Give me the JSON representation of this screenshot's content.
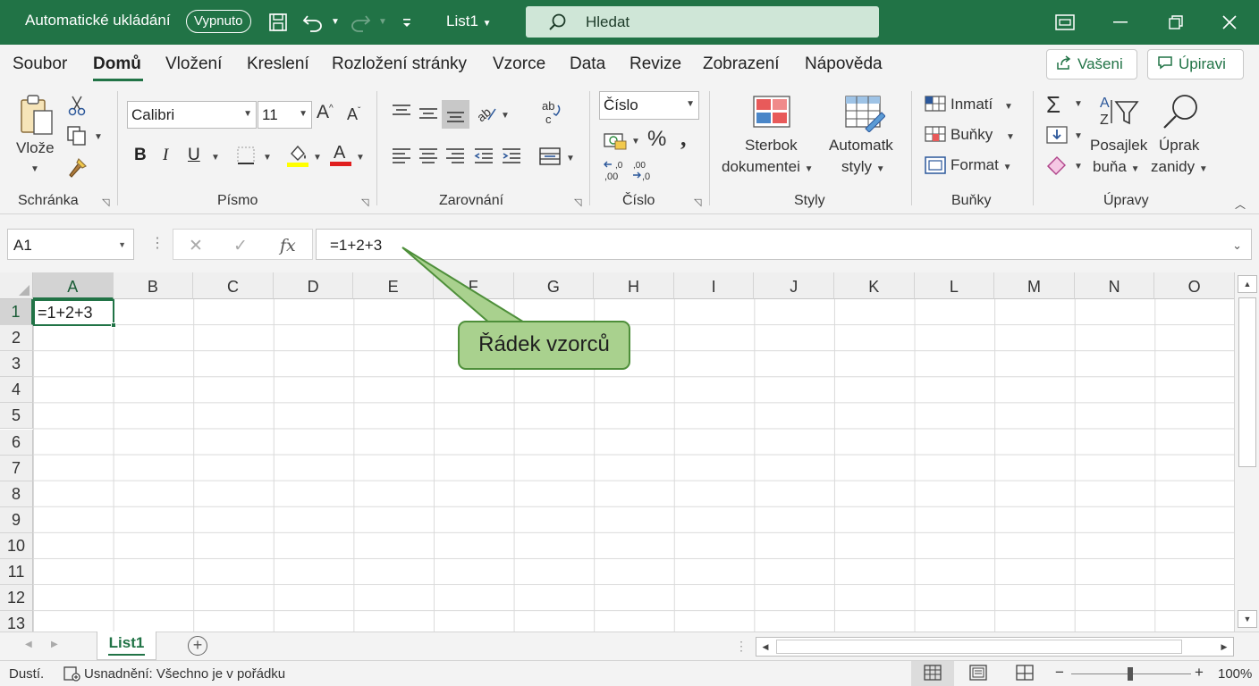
{
  "titlebar": {
    "autosave_label": "Automatické ukládání",
    "autosave_state": "Vypnuto",
    "document_name": "List1",
    "search_placeholder": "Hledat"
  },
  "menu": {
    "tabs": [
      "Soubor",
      "Domů",
      "Vložení",
      "Kreslení",
      "Rozložení stránky",
      "Vzorce",
      "Data",
      "Revize",
      "Zobrazení",
      "Nápověda"
    ],
    "active_tab": "Domů",
    "share_label": "Vašeni",
    "edit_label": "Úpiravi"
  },
  "ribbon": {
    "clipboard": {
      "label": "Schránka",
      "paste": "Vlože"
    },
    "font": {
      "label": "Písmo",
      "font_name": "Calibri",
      "font_size": "11",
      "bold": "B",
      "italic": "I",
      "underline": "U"
    },
    "alignment": {
      "label": "Zarovnání"
    },
    "number": {
      "label": "Číslo",
      "format": "Číslo"
    },
    "styles": {
      "label": "Styly",
      "cond_format_1": "Sterbok",
      "cond_format_2": "dokumentei",
      "autostyles_1": "Automatk",
      "autostyles_2": "styly"
    },
    "cells": {
      "label": "Buňky",
      "insert": "Inmatí",
      "cells": "Buňky",
      "format": "Format"
    },
    "editing": {
      "label": "Úpravy",
      "sort_1": "Posajlek",
      "sort_2": "buňa",
      "find_1": "Úprak",
      "find_2": "zanidy"
    }
  },
  "formula_bar": {
    "name_box": "A1",
    "formula": "=1+2+3"
  },
  "grid": {
    "columns": [
      "A",
      "B",
      "C",
      "D",
      "E",
      "F",
      "G",
      "H",
      "I",
      "J",
      "K",
      "L",
      "M",
      "N",
      "O"
    ],
    "rows": [
      "1",
      "2",
      "3",
      "4",
      "5",
      "6",
      "7",
      "8",
      "9",
      "10",
      "11",
      "12",
      "13"
    ],
    "selected_cell": "A1",
    "a1_value": "=1+2+3"
  },
  "callout": {
    "text": "Řádek vzorců"
  },
  "sheets": {
    "active": "List1"
  },
  "status": {
    "mode": "Dustí.",
    "accessibility": "Usnadnění: Všechno je v pořádku",
    "zoom": "100%",
    "zoom_minus": "−",
    "zoom_plus": "+"
  },
  "colors": {
    "excel_green": "#217346",
    "callout_fill": "#a9d18e",
    "callout_border": "#4e8f3a"
  }
}
